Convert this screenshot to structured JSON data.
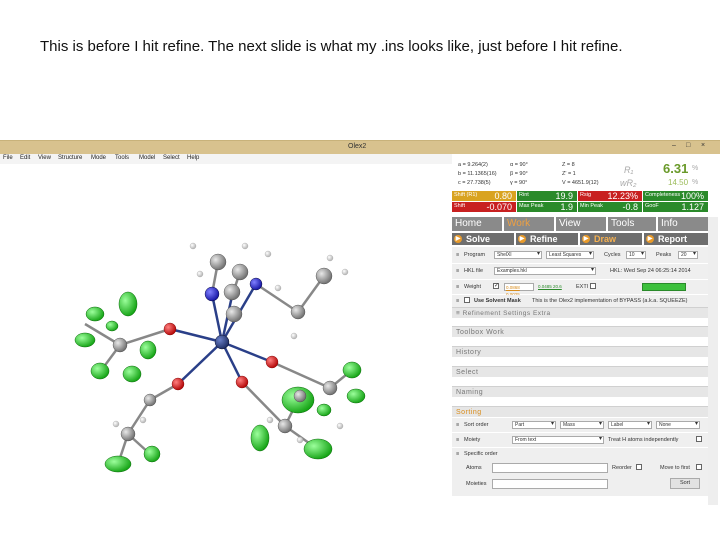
{
  "caption": "This is before I hit refine. The next slide is what my .ins looks like, just before I hit refine.",
  "window": {
    "title": "Olex2",
    "minimize": "–",
    "maximize": "□",
    "close": "×"
  },
  "menu": [
    "File",
    "Edit",
    "View",
    "Structure",
    "Mode",
    "Tools",
    "Model",
    "Select",
    "Help"
  ],
  "cell_params": [
    [
      "a = 9.264(2)",
      "α = 90°",
      "Z = 8"
    ],
    [
      "b = 11.1365(16)",
      "β = 90°",
      "Z' = 1"
    ],
    [
      "c = 27.738(5)",
      "γ = 90°",
      "V = 4651.9(12)"
    ]
  ],
  "r1": {
    "label": "R₁",
    "value": "6.31",
    "unit": "%"
  },
  "wr2": {
    "label": "wR₂",
    "value": "14.50",
    "unit": "%"
  },
  "stats": [
    {
      "label": "Shift (R1)",
      "value": "0.80",
      "color": "#d9a320"
    },
    {
      "label": "Rint",
      "value": "19.9",
      "color": "#2a8a2a"
    },
    {
      "label": "Rsig",
      "value": "12.23%",
      "color": "#c82020"
    },
    {
      "label": "Completeness",
      "value": "100%",
      "color": "#2a8a2a"
    },
    {
      "label": "Shift",
      "value": "-0.070",
      "color": "#c82020"
    },
    {
      "label": "Max Peak",
      "value": "1.9",
      "color": "#2a8a2a"
    },
    {
      "label": "Min Peak",
      "value": "-0.8",
      "color": "#2a8a2a"
    },
    {
      "label": "GooF",
      "value": "1.127",
      "color": "#2a8a2a"
    }
  ],
  "tabs": [
    "Home",
    "Work",
    "View",
    "Tools",
    "Info"
  ],
  "subtabs": [
    "Solve",
    "Refine",
    "Draw",
    "Report"
  ],
  "refine": {
    "program_label": "Program",
    "program": "ShelXl",
    "method": "Least Squares",
    "cycles_label": "Cycles",
    "cycles": "10",
    "peaks_label": "Peaks",
    "peaks": "20",
    "hkl_label": "HKL file",
    "hkl": "Examples.hkl",
    "hkl_date": "HKL: Wed Sep 24 06:25:14 2014",
    "weight_label": "Weight",
    "weight_current": "0.0868 0.0025",
    "weight_suggested": "0.0485 20.6",
    "extinction_label": "EXTI",
    "solvent_mask_label": "Use Solvent Mask",
    "solvent_mask_note": "This is the Olex2 implementation of BYPASS (a.k.a. SQUEEZE)",
    "extra": "Refinement Settings Extra"
  },
  "sections": [
    "Toolbox Work",
    "History",
    "Select",
    "Naming",
    "Sorting"
  ],
  "sorting": {
    "sort_order_label": "Sort order",
    "sort_1": "Part",
    "sort_2": "Mass",
    "sort_3": "Label",
    "sort_4": "None",
    "moiety_label": "Moiety",
    "moiety": "From text",
    "moiety_note": "Treat H atoms independently",
    "specific_label": "Specific order",
    "atoms_label": "Atoms",
    "reorder_label": "Reorder",
    "move_label": "Move to first",
    "moieties_label": "Moieties",
    "sort_button": "Sort"
  },
  "colors": {
    "carbon": "#8c8c8c",
    "oxygen": "#e01818",
    "nitrogen": "#2838d8",
    "chlorine": "#2ccf2c",
    "metal": "#2a3f88",
    "hydrogen": "#e8e8e8"
  }
}
